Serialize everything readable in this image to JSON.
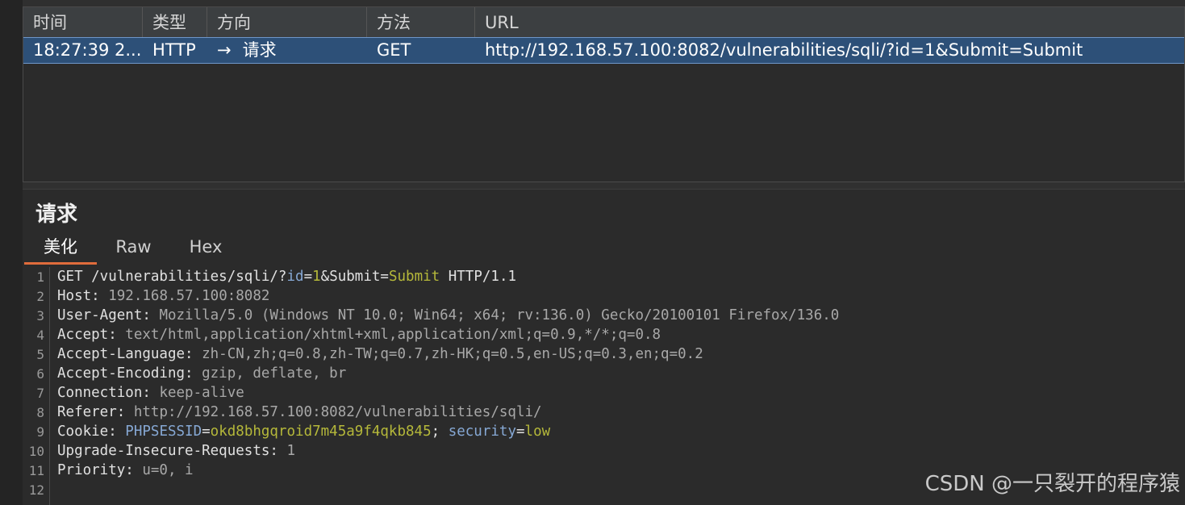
{
  "history": {
    "columns": [
      "时间",
      "类型",
      "方向",
      "方法",
      "URL"
    ],
    "rows": [
      {
        "time": "18:27:39 2...",
        "type": "HTTP",
        "direction_icon": "right-arrow-icon",
        "direction": "请求",
        "method": "GET",
        "url": "http://192.168.57.100:8082/vulnerabilities/sqli/?id=1&Submit=Submit"
      }
    ]
  },
  "request": {
    "title": "请求",
    "tabs": [
      "美化",
      "Raw",
      "Hex"
    ],
    "active_tab": "美化",
    "line_numbers": [
      "1",
      "2",
      "3",
      "4",
      "5",
      "6",
      "7",
      "8",
      "9",
      "10",
      "11",
      "12"
    ],
    "lines": {
      "l1": {
        "a": "GET /vulnerabilities/sqli/?",
        "b": "id",
        "c": "=",
        "d": "1",
        "e": "&",
        "f": "Submit",
        "g": "=",
        "h": "Submit",
        "i": " HTTP/1.1"
      },
      "l2": {
        "key": "Host:",
        "val": " 192.168.57.100:8082"
      },
      "l3": {
        "key": "User-Agent:",
        "val": " Mozilla/5.0 (Windows NT 10.0; Win64; x64; rv:136.0) Gecko/20100101 Firefox/136.0"
      },
      "l4": {
        "key": "Accept:",
        "val": " text/html,application/xhtml+xml,application/xml;q=0.9,*/*;q=0.8"
      },
      "l5": {
        "key": "Accept-Language:",
        "val": " zh-CN,zh;q=0.8,zh-TW;q=0.7,zh-HK;q=0.5,en-US;q=0.3,en;q=0.2"
      },
      "l6": {
        "key": "Accept-Encoding:",
        "val": " gzip, deflate, br"
      },
      "l7": {
        "key": "Connection:",
        "val": " keep-alive"
      },
      "l8": {
        "key": "Referer:",
        "val": " http://192.168.57.100:8082/vulnerabilities/sqli/"
      },
      "l9": {
        "key": "Cookie:",
        "c1": " PHPSESSID",
        "c2": "=",
        "c3": "okd8bhgqroid7m45a9f4qkb845",
        "c4": "; ",
        "c5": "security",
        "c6": "=",
        "c7": "low"
      },
      "l10": {
        "key": "Upgrade-Insecure-Requests:",
        "val": " 1"
      },
      "l11": {
        "key": "Priority:",
        "val": " u=0, i"
      }
    }
  },
  "watermark": "CSDN @一只裂开的程序猿",
  "colors": {
    "selection": "#2d5078",
    "tab_underline": "#e06c3c",
    "param_value": "#b5b83a",
    "cookie_key": "#86a8d4"
  }
}
